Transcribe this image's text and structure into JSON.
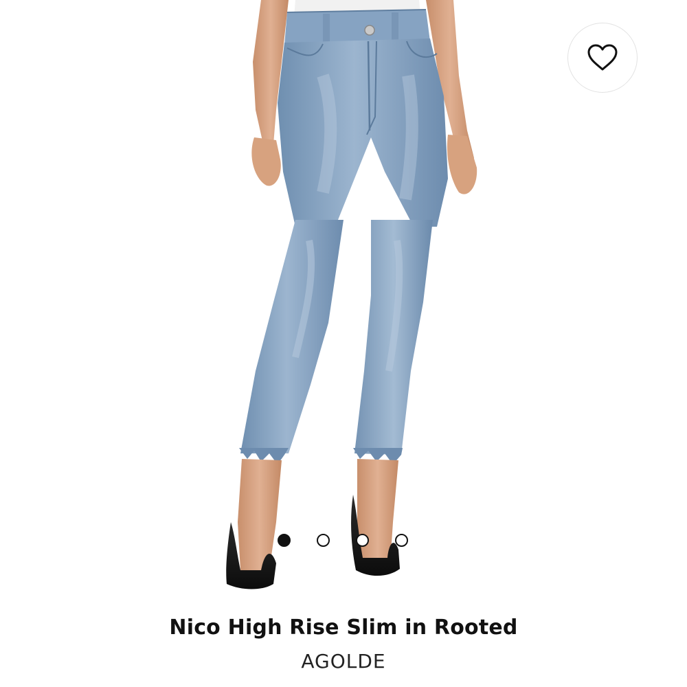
{
  "product": {
    "title": "Nico High Rise Slim in Rooted",
    "brand": "AGOLDE",
    "image_alt": "Model wearing light wash high rise slim jeans with frayed hems and black pumps"
  },
  "favorite": {
    "icon": "heart-outline-icon"
  },
  "carousel": {
    "total": 4,
    "active_index": 0
  },
  "colors": {
    "denim": "#8fa9c4",
    "heels": "#1a1a1a",
    "skin": "#d9a482"
  }
}
